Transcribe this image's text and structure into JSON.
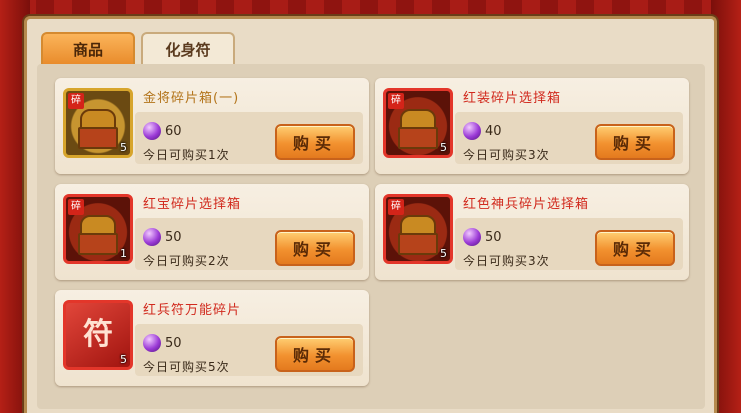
{
  "tabs": [
    {
      "label": "商品",
      "active": true
    },
    {
      "label": "化身符",
      "active": false
    }
  ],
  "currency_icon": "purple-gem-icon",
  "colors": {
    "item_name_red": "#d12a1e",
    "item_name_gold": "#b3741a",
    "buy_button": "#f2912f"
  },
  "items": [
    {
      "name": "金将碎片箱(一)",
      "name_color": "gold",
      "price": "60",
      "limit": "今日可购买1次",
      "count": "5",
      "tag": "碎",
      "icon": "gold-chest-icon",
      "buy_label": "购买"
    },
    {
      "name": "红装碎片选择箱",
      "name_color": "red",
      "price": "40",
      "limit": "今日可购买3次",
      "count": "5",
      "tag": "碎",
      "icon": "red-equipment-chest-icon",
      "buy_label": "购买"
    },
    {
      "name": "红宝碎片选择箱",
      "name_color": "red",
      "price": "50",
      "limit": "今日可购买2次",
      "count": "1",
      "tag": "碎",
      "icon": "red-gem-chest-icon",
      "buy_label": "购买"
    },
    {
      "name": "红色神兵碎片选择箱",
      "name_color": "red",
      "price": "50",
      "limit": "今日可购买3次",
      "count": "5",
      "tag": "碎",
      "icon": "red-weapon-chest-icon",
      "buy_label": "购买"
    },
    {
      "name": "红兵符万能碎片",
      "name_color": "red",
      "price": "50",
      "limit": "今日可购买5次",
      "count": "5",
      "tag": "",
      "icon": "fu-talisman-icon",
      "icon_text": "符",
      "buy_label": "购买"
    }
  ]
}
